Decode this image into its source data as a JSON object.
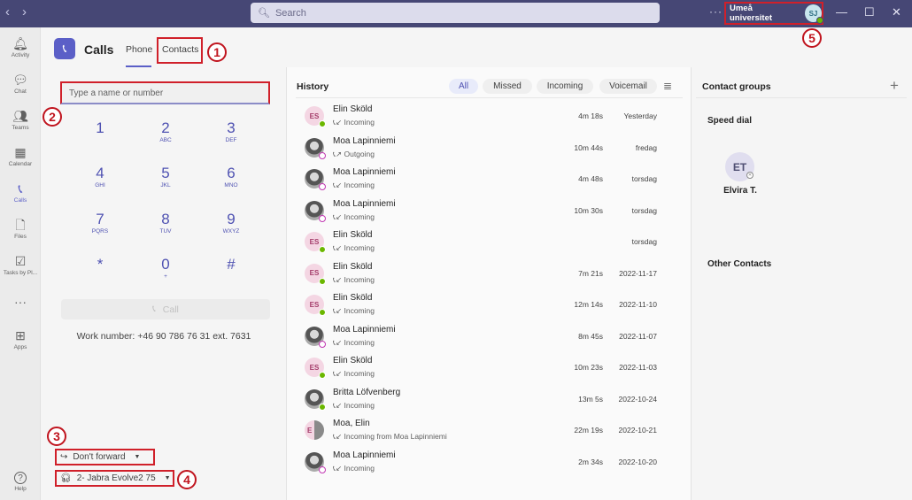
{
  "titlebar": {
    "back_icon": "chevron-left-icon",
    "forward_icon": "chevron-right-icon",
    "search_placeholder": "Search",
    "more_label": "···",
    "org_name": "Umeå universitet",
    "user_initials": "SJ",
    "minimize": "—",
    "maximize": "☐",
    "close": "✕"
  },
  "annotations": [
    "1",
    "2",
    "3",
    "4",
    "5"
  ],
  "rail": {
    "items": [
      {
        "label": "Activity",
        "icon": "bell-icon",
        "glyph": "🔔︎"
      },
      {
        "label": "Chat",
        "icon": "chat-icon",
        "glyph": "💬︎"
      },
      {
        "label": "Teams",
        "icon": "teams-icon",
        "glyph": "👥︎"
      },
      {
        "label": "Calendar",
        "icon": "calendar-icon",
        "glyph": "▦"
      },
      {
        "label": "Calls",
        "icon": "phone-icon",
        "glyph": "📞︎"
      },
      {
        "label": "Files",
        "icon": "file-icon",
        "glyph": "🗋"
      },
      {
        "label": "Tasks by Pl...",
        "icon": "tasks-icon",
        "glyph": "☑"
      },
      {
        "label": "",
        "icon": "more-icon",
        "glyph": "···"
      },
      {
        "label": "Apps",
        "icon": "apps-icon",
        "glyph": "⊞"
      }
    ],
    "help_label": "Help",
    "help_glyph": "?"
  },
  "header": {
    "title": "Calls",
    "tabs": [
      "Phone",
      "Contacts"
    ],
    "active_tab": "Phone"
  },
  "dialpad": {
    "input_placeholder": "Type a name or number",
    "keys": [
      {
        "digit": "1",
        "letters": ""
      },
      {
        "digit": "2",
        "letters": "ABC"
      },
      {
        "digit": "3",
        "letters": "DEF"
      },
      {
        "digit": "4",
        "letters": "GHI"
      },
      {
        "digit": "5",
        "letters": "JKL"
      },
      {
        "digit": "6",
        "letters": "MNO"
      },
      {
        "digit": "7",
        "letters": "PQRS"
      },
      {
        "digit": "8",
        "letters": "TUV"
      },
      {
        "digit": "9",
        "letters": "WXYZ"
      },
      {
        "digit": "*",
        "letters": ""
      },
      {
        "digit": "0",
        "letters": "+"
      },
      {
        "digit": "#",
        "letters": ""
      }
    ],
    "call_label": "Call",
    "work_number": "Work number: +46 90 786 76 31 ext. 7631",
    "forward_label": "Don't forward",
    "device_label": "2- Jabra Evolve2 75"
  },
  "history": {
    "title": "History",
    "filters": [
      "All",
      "Missed",
      "Incoming",
      "Voicemail"
    ],
    "active_filter": "All",
    "rows": [
      {
        "name": "Elin Sköld",
        "initials": "ES",
        "avatar": "initials",
        "presence": "available",
        "type": "Incoming",
        "duration": "4m 18s",
        "date": "Yesterday"
      },
      {
        "name": "Moa Lapinniemi",
        "initials": "",
        "avatar": "photo",
        "presence": "out-of-office",
        "type": "Outgoing",
        "duration": "10m 44s",
        "date": "fredag"
      },
      {
        "name": "Moa Lapinniemi",
        "initials": "",
        "avatar": "photo",
        "presence": "out-of-office",
        "type": "Incoming",
        "duration": "4m 48s",
        "date": "torsdag"
      },
      {
        "name": "Moa Lapinniemi",
        "initials": "",
        "avatar": "photo",
        "presence": "out-of-office",
        "type": "Incoming",
        "duration": "10m 30s",
        "date": "torsdag"
      },
      {
        "name": "Elin Sköld",
        "initials": "ES",
        "avatar": "initials",
        "presence": "available",
        "type": "Incoming",
        "duration": "",
        "date": "torsdag"
      },
      {
        "name": "Elin Sköld",
        "initials": "ES",
        "avatar": "initials",
        "presence": "available",
        "type": "Incoming",
        "duration": "7m 21s",
        "date": "2022-11-17"
      },
      {
        "name": "Elin Sköld",
        "initials": "ES",
        "avatar": "initials",
        "presence": "available",
        "type": "Incoming",
        "duration": "12m 14s",
        "date": "2022-11-10"
      },
      {
        "name": "Moa Lapinniemi",
        "initials": "",
        "avatar": "photo",
        "presence": "out-of-office",
        "type": "Incoming",
        "duration": "8m 45s",
        "date": "2022-11-07"
      },
      {
        "name": "Elin Sköld",
        "initials": "ES",
        "avatar": "initials",
        "presence": "available",
        "type": "Incoming",
        "duration": "10m 23s",
        "date": "2022-11-03"
      },
      {
        "name": "Britta Löfvenberg",
        "initials": "",
        "avatar": "photo",
        "presence": "available",
        "type": "Incoming",
        "duration": "13m 5s",
        "date": "2022-10-24"
      },
      {
        "name": "Moa, Elin",
        "initials": "E",
        "avatar": "split",
        "presence": "",
        "type": "Incoming from Moa Lapinniemi",
        "duration": "22m 19s",
        "date": "2022-10-21"
      },
      {
        "name": "Moa Lapinniemi",
        "initials": "",
        "avatar": "photo",
        "presence": "out-of-office",
        "type": "Incoming",
        "duration": "2m 34s",
        "date": "2022-10-20"
      }
    ]
  },
  "contact_groups": {
    "title": "Contact groups",
    "add_glyph": "+",
    "speed_dial_label": "Speed dial",
    "speed_dial": [
      {
        "initials": "ET",
        "name": "Elvira T."
      }
    ],
    "other_contacts_label": "Other Contacts"
  },
  "colors": {
    "titlebar": "#464775",
    "accent": "#5b5fc7",
    "annotation_red": "#d0202a",
    "available": "#6bb700",
    "out_of_office": "#c239b3"
  }
}
